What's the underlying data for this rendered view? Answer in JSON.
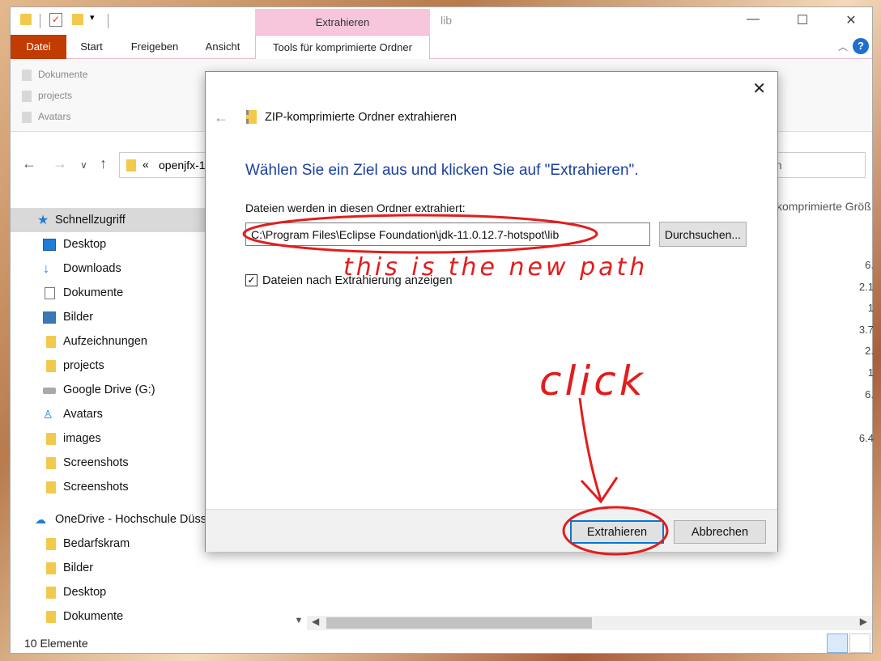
{
  "explorer": {
    "ribbon_context_label": "Extrahieren",
    "window_title": "lib",
    "tabs": [
      "Datei",
      "Start",
      "Freigeben",
      "Ansicht",
      "Tools für komprimierte Ordner"
    ],
    "ribbon_items": [
      "Dokumente",
      "projects",
      "Avatars"
    ],
    "address_chevron": "«",
    "address_text": "openjfx-1",
    "search_partial": "en",
    "column_header_partial": "komprimierte Größ",
    "size_values": [
      "6.",
      "2.1",
      "1",
      "3.7",
      "2.",
      "1",
      "6.",
      "6.4"
    ],
    "nav_items": [
      {
        "label": "Schnellzugriff",
        "icon": "star-icon"
      },
      {
        "label": "Desktop",
        "icon": "desktop-icon"
      },
      {
        "label": "Downloads",
        "icon": "download-icon"
      },
      {
        "label": "Dokumente",
        "icon": "document-icon"
      },
      {
        "label": "Bilder",
        "icon": "pictures-icon"
      },
      {
        "label": "Aufzeichnungen",
        "icon": "folder-icon"
      },
      {
        "label": "projects",
        "icon": "folder-icon"
      },
      {
        "label": "Google Drive (G:)",
        "icon": "drive-icon"
      },
      {
        "label": "Avatars",
        "icon": "person-folder-icon"
      },
      {
        "label": "images",
        "icon": "folder-icon"
      },
      {
        "label": "Screenshots",
        "icon": "folder-icon"
      },
      {
        "label": "Screenshots",
        "icon": "folder-icon"
      },
      {
        "label": "OneDrive - Hochschule Düss",
        "icon": "cloud-icon"
      },
      {
        "label": "Bedarfskram",
        "icon": "folder-icon"
      },
      {
        "label": "Bilder",
        "icon": "folder-icon"
      },
      {
        "label": "Desktop",
        "icon": "folder-icon"
      },
      {
        "label": "Dokumente",
        "icon": "folder-icon"
      }
    ],
    "status_count": "10 Elemente"
  },
  "dialog": {
    "title": "ZIP-komprimierte Ordner extrahieren",
    "heading": "Wählen Sie ein Ziel aus und klicken Sie auf \"Extrahieren\".",
    "label": "Dateien werden in diesen Ordner extrahiert:",
    "path_value": "C:\\Program Files\\Eclipse Foundation\\jdk-11.0.12.7-hotspot\\lib",
    "browse_label": "Durchsuchen...",
    "checkbox_label": "Dateien nach Extrahierung anzeigen",
    "checkbox_checked": true,
    "extract_label": "Extrahieren",
    "cancel_label": "Abbrechen"
  },
  "annotations": {
    "path_note": "this is the new path",
    "click_note": "click",
    "color": "#e21d1d"
  }
}
